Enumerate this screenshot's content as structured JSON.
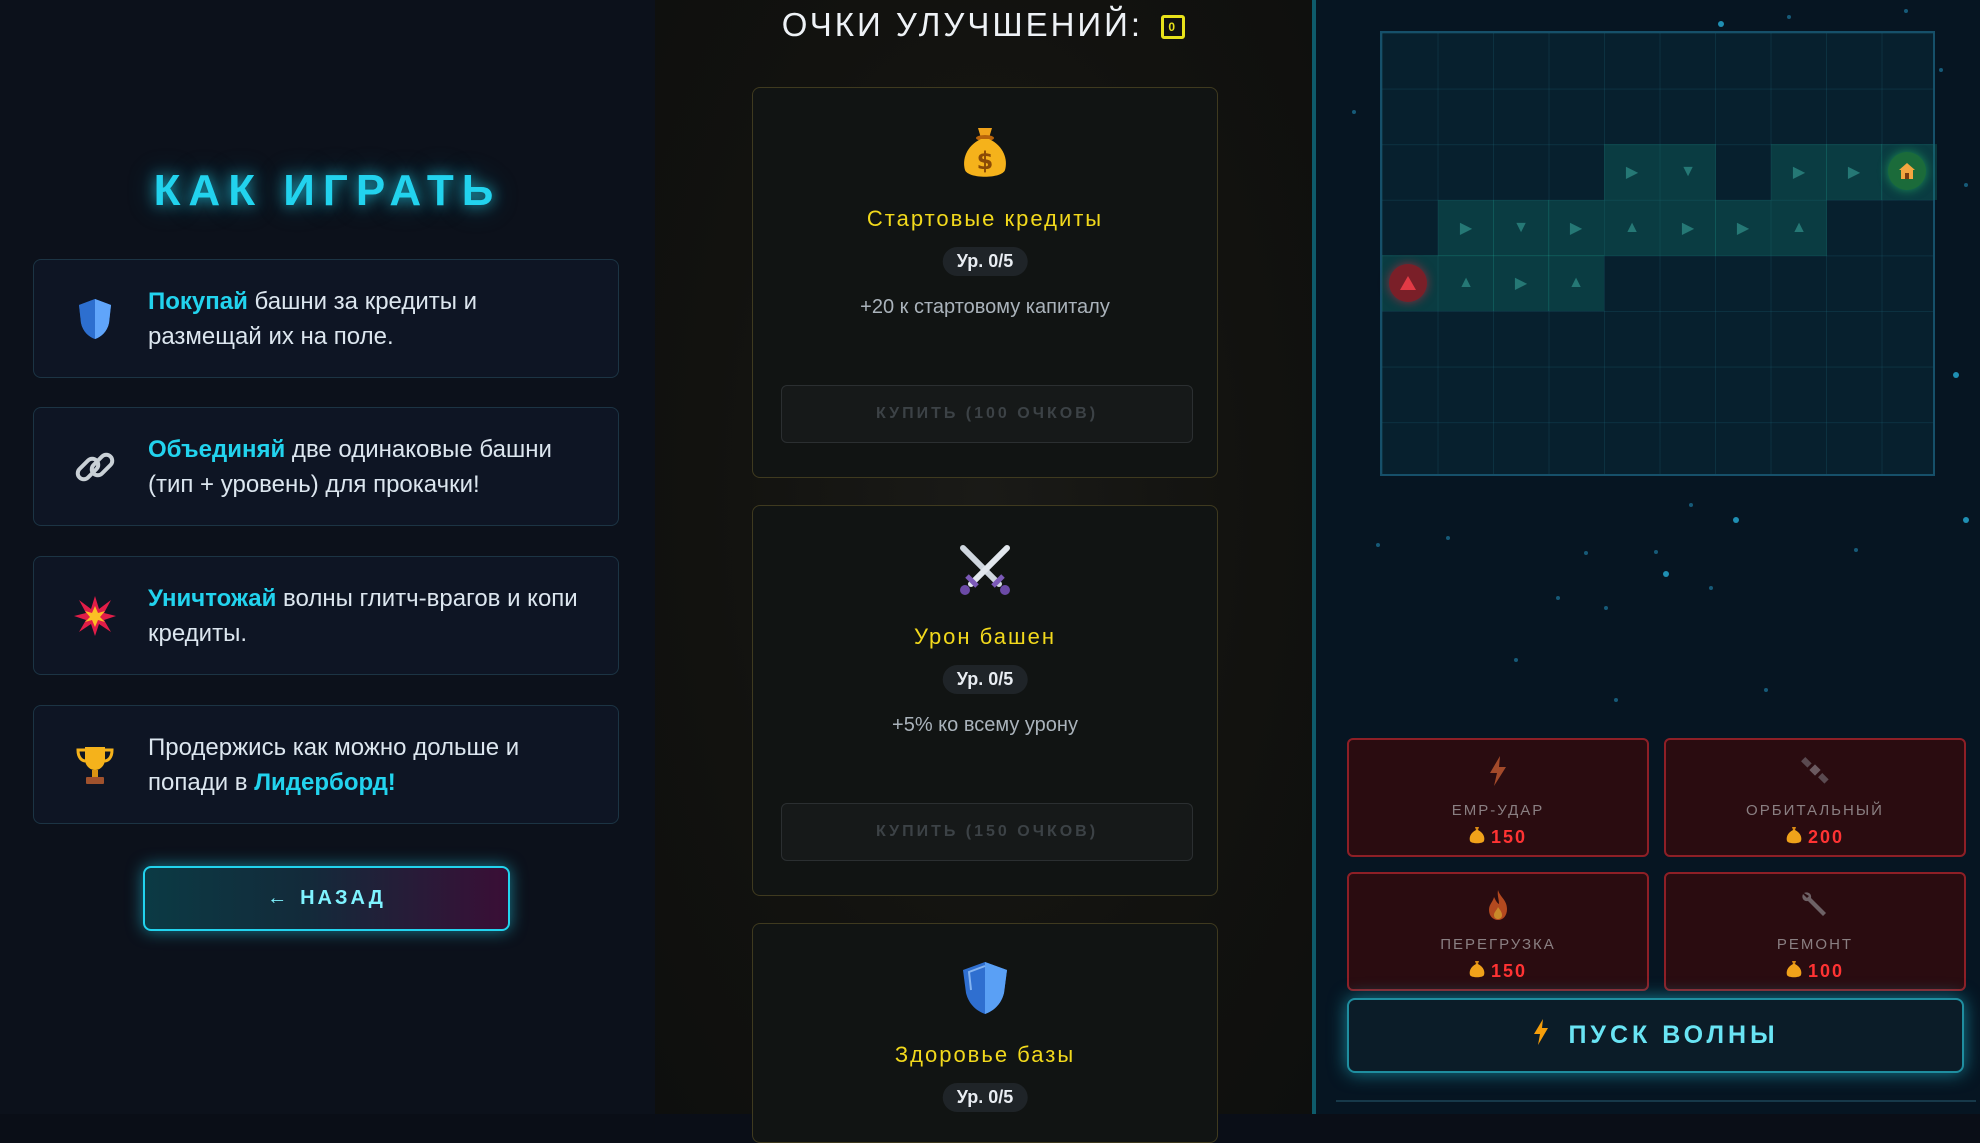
{
  "how_to_play": {
    "title": "КАК ИГРАТЬ",
    "rules": [
      {
        "icon": "shield-icon",
        "highlight": "Покупай",
        "text": " башни за кредиты и размещай их на поле."
      },
      {
        "icon": "link-icon",
        "highlight": "Объединяй",
        "text": " две одинаковые башни (тип + уровень) для прокачки!"
      },
      {
        "icon": "explosion-icon",
        "highlight": "Уничтожай",
        "text": " волны глитч-врагов и копи кредиты."
      },
      {
        "icon": "trophy-icon",
        "text_before": "Продержись как можно дольше и попади в ",
        "highlight": "Лидерборд!"
      }
    ],
    "back_label": "НАЗАД",
    "back_arrow": "←"
  },
  "upgrades": {
    "title": "ОЧКИ УЛУЧШЕНИЙ:",
    "points": "0",
    "items": [
      {
        "icon": "money-bag-icon",
        "name": "Стартовые кредиты",
        "level": "Ур. 0/5",
        "desc": "+20 к стартовому капиталу",
        "buy": "КУПИТЬ (100 ОЧКОВ)"
      },
      {
        "icon": "crossed-swords-icon",
        "name": "Урон башен",
        "level": "Ур. 0/5",
        "desc": "+5% ко всему урону",
        "buy": "КУПИТЬ (150 ОЧКОВ)"
      },
      {
        "icon": "shield-icon",
        "name": "Здоровье базы",
        "level": "Ур. 0/5"
      }
    ]
  },
  "game": {
    "abilities": [
      {
        "icon": "lightning-icon",
        "name": "EMP-УДАР",
        "cost": "150"
      },
      {
        "icon": "satellite-icon",
        "name": "ОРБИТАЛЬНЫЙ",
        "cost": "200"
      },
      {
        "icon": "fire-icon",
        "name": "ПЕРЕГРУЗКА",
        "cost": "150"
      },
      {
        "icon": "wrench-icon",
        "name": "РЕМОНТ",
        "cost": "100"
      }
    ],
    "wave_button": "ПУСК ВОЛНЫ",
    "colors": {
      "accent": "#22d3ee",
      "gold": "#f2d91c",
      "danger": "#ff3333"
    }
  }
}
